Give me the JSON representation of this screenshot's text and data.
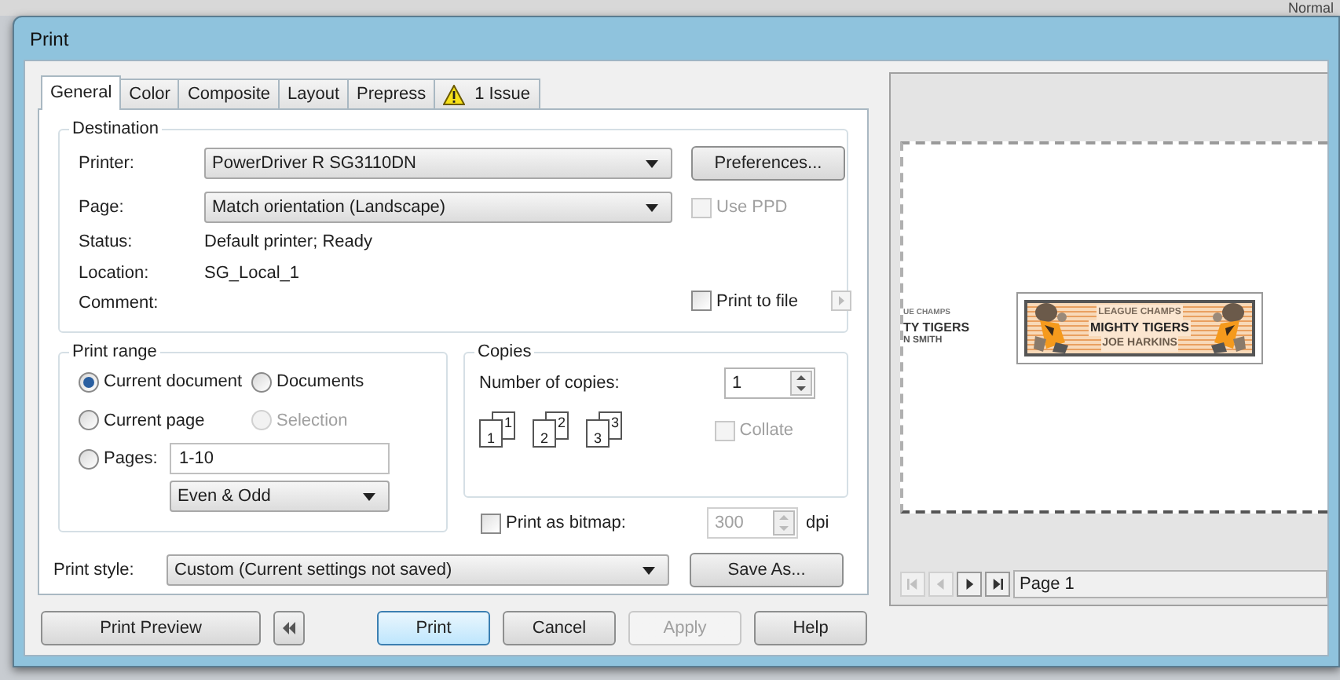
{
  "background_text": "Normal",
  "window": {
    "title": "Print"
  },
  "tabs": [
    {
      "label": "General",
      "selected": true,
      "kind": "plain"
    },
    {
      "label": "Color",
      "selected": false,
      "kind": "plain"
    },
    {
      "label": "Composite",
      "selected": false,
      "kind": "plain"
    },
    {
      "label": "Layout",
      "selected": false,
      "kind": "plain"
    },
    {
      "label": "Prepress",
      "selected": false,
      "kind": "plain"
    },
    {
      "label": "1 Issue",
      "selected": false,
      "kind": "warning"
    }
  ],
  "destination": {
    "legend": "Destination",
    "printer": {
      "label": "Printer:",
      "value": "PowerDriver R SG3110DN"
    },
    "preferences_button": "Preferences...",
    "page": {
      "label": "Page:",
      "value": "Match orientation (Landscape)"
    },
    "use_ppd": {
      "label": "Use PPD",
      "checked": false,
      "disabled": true
    },
    "status": {
      "label": "Status:",
      "value": "Default printer; Ready"
    },
    "location": {
      "label": "Location:",
      "value": "SG_Local_1"
    },
    "comment": {
      "label": "Comment:"
    },
    "print_to_file": {
      "label": "Print to file",
      "checked": false
    }
  },
  "print_range": {
    "legend": "Print range",
    "options": [
      {
        "label": "Current document",
        "selected": true,
        "disabled": false
      },
      {
        "label": "Documents",
        "selected": false,
        "disabled": false
      },
      {
        "label": "Current page",
        "selected": false,
        "disabled": false
      },
      {
        "label": "Selection",
        "selected": false,
        "disabled": true
      },
      {
        "label": "Pages:",
        "selected": false,
        "disabled": false
      }
    ],
    "pages_value": "1-10",
    "parity": "Even & Odd"
  },
  "copies": {
    "legend": "Copies",
    "label": "Number of copies:",
    "value": "1",
    "pages": [
      {
        "back": "1",
        "front": "1"
      },
      {
        "back": "2",
        "front": "2"
      },
      {
        "back": "3",
        "front": "3"
      }
    ],
    "collate": {
      "label": "Collate",
      "checked": false,
      "disabled": true
    }
  },
  "bitmap": {
    "label": "Print as bitmap:",
    "checked": false,
    "dpi": "300",
    "unit": "dpi"
  },
  "print_style": {
    "label": "Print style:",
    "value": "Custom (Current settings not saved)",
    "save_button": "Save As..."
  },
  "buttons": [
    {
      "label": "Print Preview",
      "kind": "text",
      "disabled": false,
      "default": false
    },
    {
      "kind": "collapse",
      "disabled": false,
      "default": false
    },
    {
      "label": "Print",
      "kind": "text",
      "disabled": false,
      "default": true
    },
    {
      "label": "Cancel",
      "kind": "text",
      "disabled": false,
      "default": false
    },
    {
      "label": "Apply",
      "kind": "text",
      "disabled": true,
      "default": false
    },
    {
      "label": "Help",
      "kind": "text",
      "disabled": false,
      "default": false
    }
  ],
  "preview": {
    "left_label": [
      "UE CHAMPS",
      "TY TIGERS",
      "N SMITH"
    ],
    "card": [
      "LEAGUE CHAMPS",
      "MIGHTY TIGERS",
      "JOE HARKINS"
    ],
    "nav": [
      {
        "kind": "first",
        "disabled": true
      },
      {
        "kind": "prev",
        "disabled": true
      },
      {
        "kind": "next",
        "disabled": false
      },
      {
        "kind": "last",
        "disabled": false
      }
    ],
    "page_label": "Page 1"
  }
}
